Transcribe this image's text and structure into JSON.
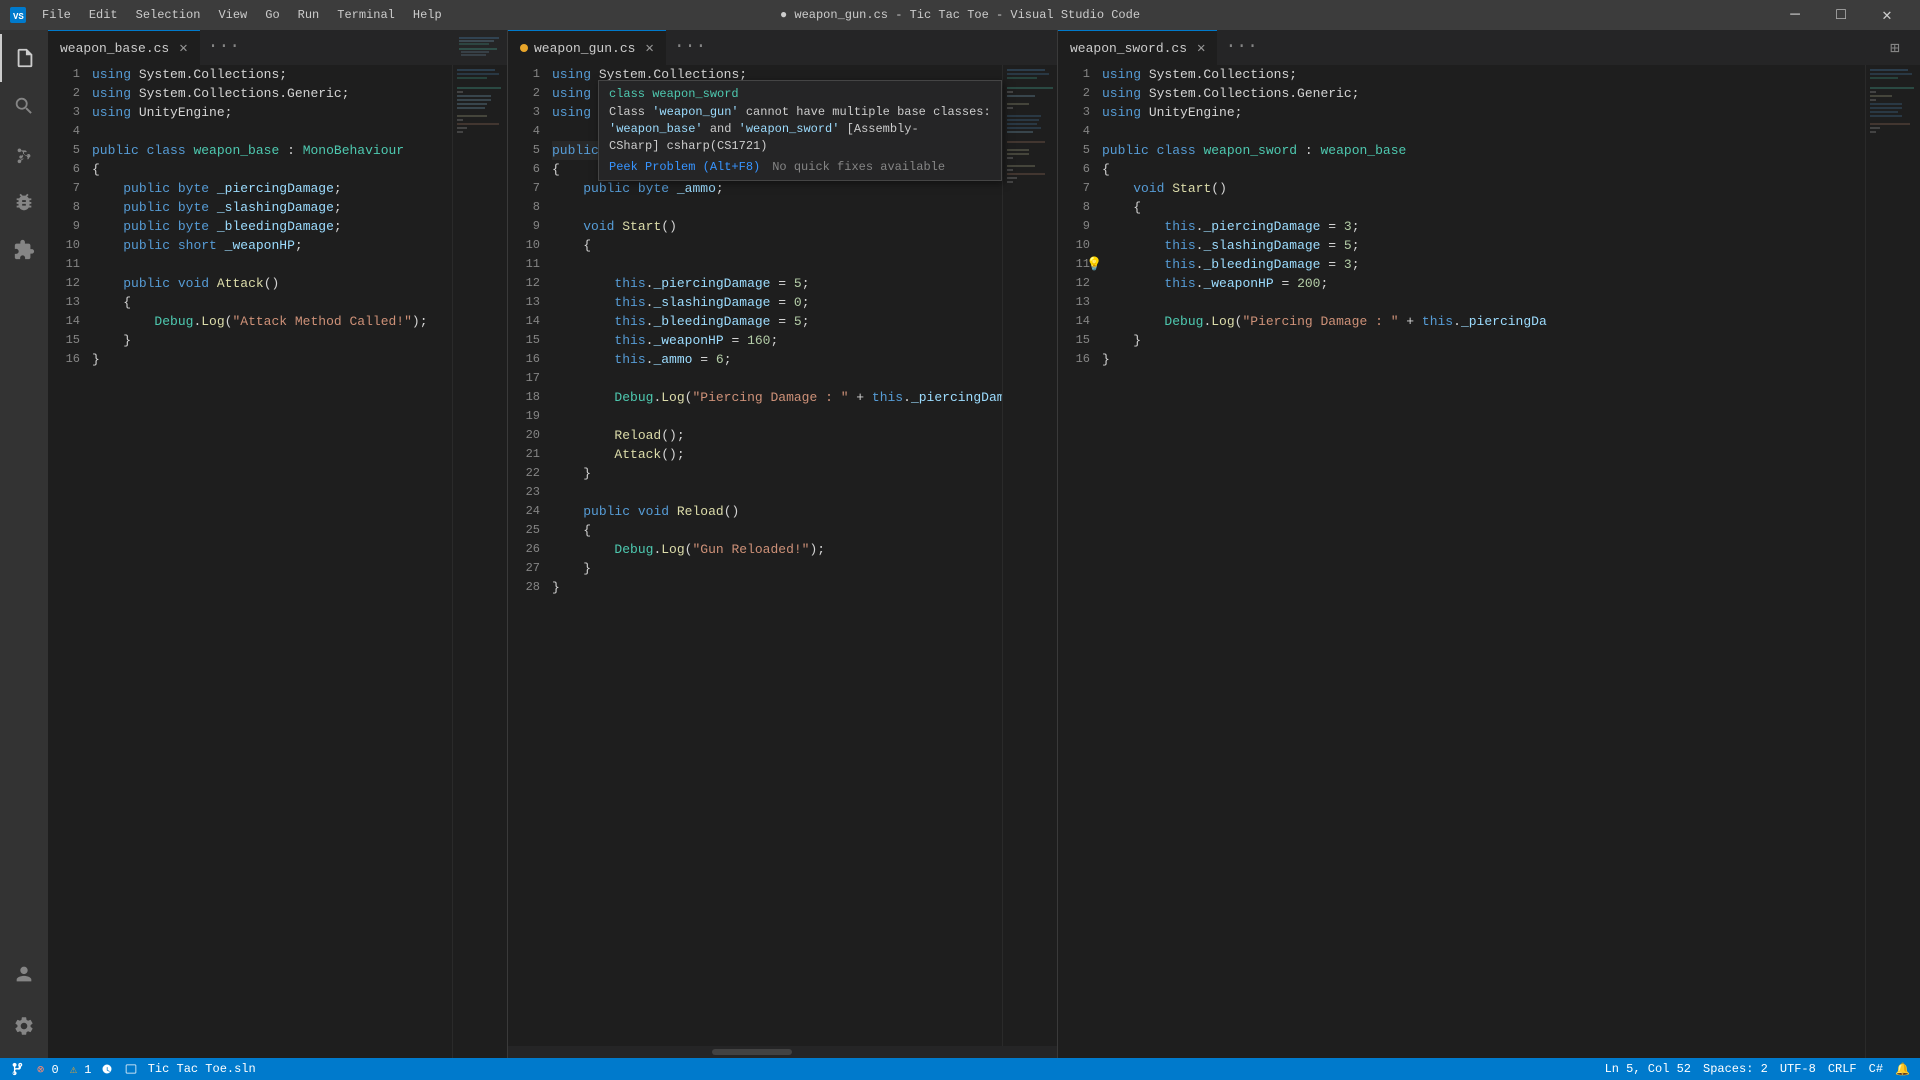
{
  "window": {
    "title": "● weapon_gun.cs - Tic Tac Toe - Visual Studio Code"
  },
  "menu": {
    "items": [
      "File",
      "Edit",
      "Selection",
      "View",
      "Go",
      "Run",
      "Terminal",
      "Help"
    ]
  },
  "title_controls": {
    "minimize": "─",
    "maximize": "□",
    "close": "✕"
  },
  "tabs": {
    "pane1": {
      "filename": "weapon_base.cs",
      "modified": false,
      "active": true
    },
    "pane2": {
      "filename": "weapon_gun.cs",
      "modified": true,
      "active": true
    },
    "pane3": {
      "filename": "weapon_sword.cs",
      "modified": false,
      "active": true
    }
  },
  "hover_tooltip": {
    "class_line": "class weapon_sword",
    "error_message": "Class 'weapon_gun' cannot have multiple base classes: 'weapon_base' and 'weapon_sword' [Assembly-CSharp] csharp(CS1721)",
    "peek_problem": "Peek Problem (Alt+F8)",
    "no_quick_fixes": "No quick fixes available"
  },
  "pane1_code": {
    "lines": [
      {
        "n": 1,
        "text": "using System.Collections;"
      },
      {
        "n": 2,
        "text": "using System.Collections.Generic;"
      },
      {
        "n": 3,
        "text": "using UnityEngine;"
      },
      {
        "n": 4,
        "text": ""
      },
      {
        "n": 5,
        "text": "public class weapon_base : MonoBehaviour"
      },
      {
        "n": 6,
        "text": "{"
      },
      {
        "n": 7,
        "text": "    public byte _piercingDamage;"
      },
      {
        "n": 8,
        "text": "    public byte _slashingDamage;"
      },
      {
        "n": 9,
        "text": "    public byte _bleedingDamage;"
      },
      {
        "n": 10,
        "text": "    public short _weaponHP;"
      },
      {
        "n": 11,
        "text": ""
      },
      {
        "n": 12,
        "text": "    public void Attack()"
      },
      {
        "n": 13,
        "text": "    {"
      },
      {
        "n": 14,
        "text": "        Debug.Log(\"Attack Method Called!\");"
      },
      {
        "n": 15,
        "text": "    }"
      },
      {
        "n": 16,
        "text": "}"
      }
    ]
  },
  "pane2_code": {
    "lines": [
      {
        "n": 1,
        "text": "using System.Collections;"
      },
      {
        "n": 2,
        "text": "using System.Collections.Generic;"
      },
      {
        "n": 3,
        "text": "using UnityEngine;"
      },
      {
        "n": 4,
        "text": ""
      },
      {
        "n": 5,
        "text": "public class weapon_gun : weapon_base, weapon_sword"
      },
      {
        "n": 6,
        "text": "{"
      },
      {
        "n": 7,
        "text": "    public byte _ammo;"
      },
      {
        "n": 8,
        "text": ""
      },
      {
        "n": 9,
        "text": "    void Start()"
      },
      {
        "n": 10,
        "text": "    {"
      },
      {
        "n": 11,
        "text": ""
      },
      {
        "n": 12,
        "text": "        this._piercingDamage = 5;"
      },
      {
        "n": 13,
        "text": "        this._slashingDamage = 0;"
      },
      {
        "n": 14,
        "text": "        this._bleedingDamage = 5;"
      },
      {
        "n": 15,
        "text": "        this._weaponHP = 160;"
      },
      {
        "n": 16,
        "text": "        this._ammo = 6;"
      },
      {
        "n": 17,
        "text": ""
      },
      {
        "n": 18,
        "text": "        Debug.Log(\"Piercing Damage : \" + this._piercingDamage + \", Slashing D"
      },
      {
        "n": 19,
        "text": ""
      },
      {
        "n": 20,
        "text": "        Reload();"
      },
      {
        "n": 21,
        "text": "        Attack();"
      },
      {
        "n": 22,
        "text": "    }"
      },
      {
        "n": 23,
        "text": ""
      },
      {
        "n": 24,
        "text": "    public void Reload()"
      },
      {
        "n": 25,
        "text": "    {"
      },
      {
        "n": 26,
        "text": "        Debug.Log(\"Gun Reloaded!\");"
      },
      {
        "n": 27,
        "text": "    }"
      },
      {
        "n": 28,
        "text": "}"
      }
    ]
  },
  "pane3_code": {
    "lines": [
      {
        "n": 1,
        "text": "using System.Collections;"
      },
      {
        "n": 2,
        "text": "using System.Collections.Generic;"
      },
      {
        "n": 3,
        "text": "using UnityEngine;"
      },
      {
        "n": 4,
        "text": ""
      },
      {
        "n": 5,
        "text": "public class weapon_sword : weapon_base"
      },
      {
        "n": 6,
        "text": "{"
      },
      {
        "n": 7,
        "text": "    void Start()"
      },
      {
        "n": 8,
        "text": "    {"
      },
      {
        "n": 9,
        "text": "        this._piercingDamage = 3;"
      },
      {
        "n": 10,
        "text": "        this._slashingDamage = 5;"
      },
      {
        "n": 11,
        "text": "        this._bleedingDamage = 3;"
      },
      {
        "n": 12,
        "text": "        this._weaponHP = 200;"
      },
      {
        "n": 13,
        "text": ""
      },
      {
        "n": 14,
        "text": "        Debug.Log(\"Piercing Damage : \" + this._piercingDa"
      },
      {
        "n": 15,
        "text": "    }"
      },
      {
        "n": 16,
        "text": "}"
      }
    ]
  },
  "status_bar": {
    "errors": "0",
    "warnings": "1",
    "branch": "Tic Tac Toe.sln",
    "ln": "Ln 5, Col 52",
    "spaces": "Spaces: 2",
    "encoding": "UTF-8",
    "line_ending": "CRLF",
    "language": "C#"
  }
}
